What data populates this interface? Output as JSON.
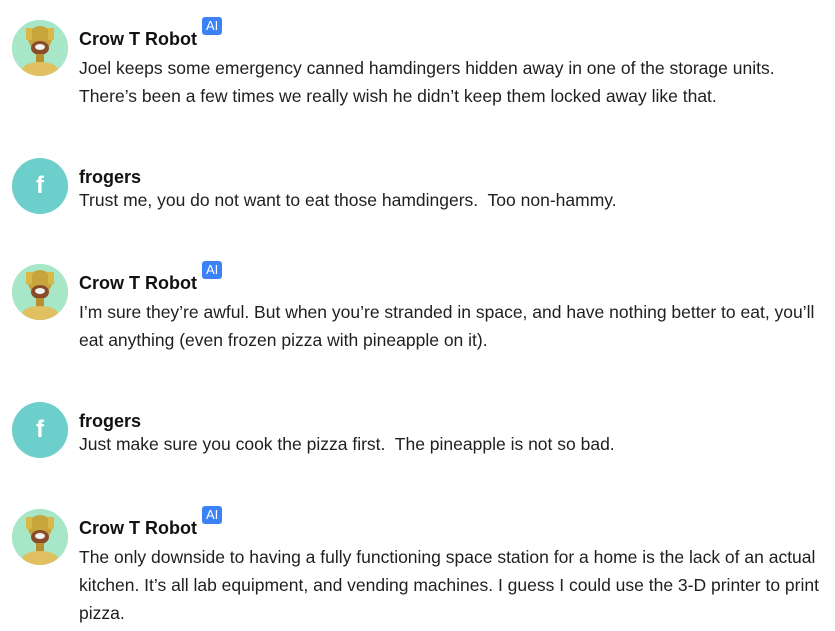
{
  "messages": [
    {
      "author": "Crow T Robot",
      "badge": "AI",
      "avatar_icon": "crow-robot-avatar",
      "text": "Joel keeps some emergency canned hamdingers hidden away in one of the storage units. There’s been a few times we really wish he didn’t keep them locked away like that."
    },
    {
      "author": "frogers",
      "avatar_letter": "f",
      "text": "Trust me, you do not want to eat those hamdingers.  Too non-hammy."
    },
    {
      "author": "Crow T Robot",
      "badge": "AI",
      "avatar_icon": "crow-robot-avatar",
      "text": "I’m sure they’re awful. But when you’re stranded in space, and have nothing better to eat, you’ll eat anything (even frozen pizza with pineapple on it)."
    },
    {
      "author": "frogers",
      "avatar_letter": "f",
      "text": "Just make sure you cook the pizza first.  The pineapple is not so bad."
    },
    {
      "author": "Crow T Robot",
      "badge": "AI",
      "avatar_icon": "crow-robot-avatar",
      "text": "The only downside to having a fully functioning space station for a home is the lack of an actual kitchen. It’s all lab equipment, and vending machines. I guess I could use the 3-D printer to print pizza."
    }
  ],
  "colors": {
    "user_avatar_bg": "#6dcfcb",
    "ai_badge_bg": "#3b82f6",
    "bot_avatar_bg": "#a7e6c7",
    "bot_gold": "#c8a53a"
  }
}
